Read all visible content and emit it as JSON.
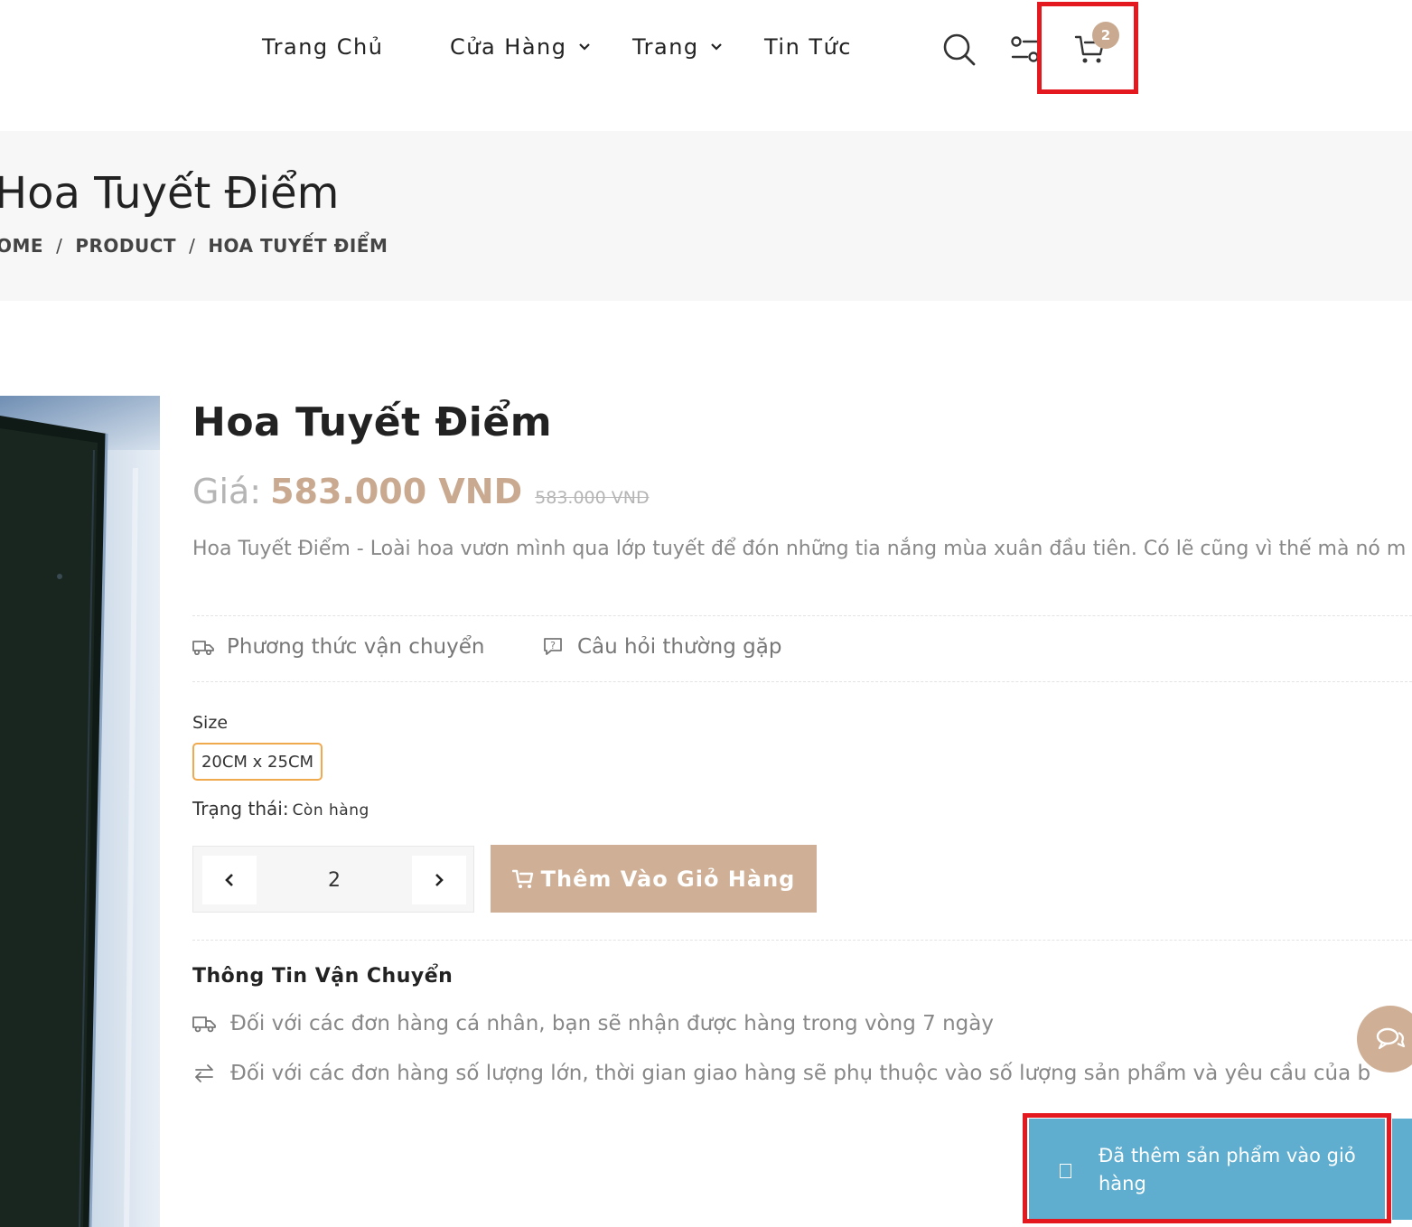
{
  "nav": {
    "home": "Trang Chủ",
    "shop": "Cửa Hàng",
    "pages": "Trang",
    "news": "Tin Tức"
  },
  "header_icons": [
    "search-icon",
    "compare-icon",
    "cart-icon"
  ],
  "cart": {
    "count": "2"
  },
  "banner": {
    "title": "Hoa Tuyết Điểm",
    "breadcrumb": [
      "OME",
      "PRODUCT",
      "HOA TUYẾT ĐIỂM"
    ]
  },
  "product": {
    "title": "Hoa Tuyết Điểm",
    "price_label": "Giá:",
    "price": "583.000 VND",
    "old_price": "583.000 VND",
    "description": "Hoa Tuyết Điểm - Loài hoa vươn mình qua lớp tuyết để đón những tia nắng mùa xuân đầu tiên. Có lẽ cũng vì thế mà nó m",
    "links": {
      "shipping": "Phương thức vận chuyển",
      "faq": "Câu hỏi thường gặp"
    },
    "size_label": "Size",
    "size_option": "20CM x 25CM",
    "status_label": "Trạng thái:",
    "status_value": "Còn hàng",
    "quantity": "2",
    "add_to_cart": "Thêm Vào Giỏ Hàng"
  },
  "shipping_info": {
    "heading": "Thông Tin Vận Chuyển",
    "lines": [
      "Đối với các đơn hàng cá nhân, bạn sẽ nhận được hàng trong vòng 7 ngày",
      "Đối với các đơn hàng số lượng lớn, thời gian giao hàng sẽ phụ thuộc vào số lượng sản phẩm và yêu cầu của b"
    ]
  },
  "toast": {
    "message": "Đã thêm sản phẩm vào giỏ hàng"
  },
  "colors": {
    "accent": "#c9a98f",
    "button": "#cfb096",
    "toast": "#5faed0",
    "highlight": "#e3191f",
    "size_border": "#f1a94e"
  }
}
